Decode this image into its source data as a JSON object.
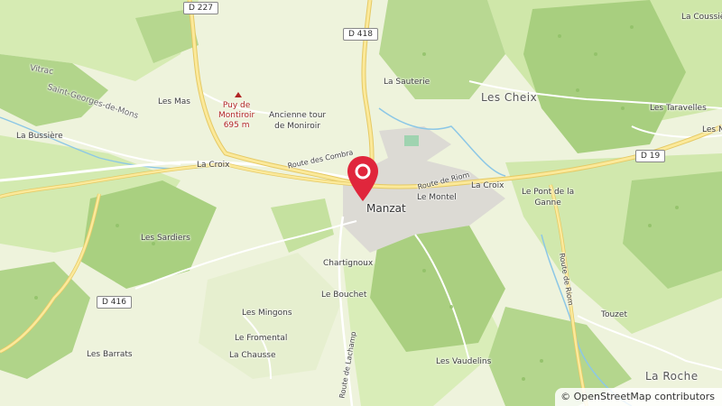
{
  "map": {
    "places": {
      "la_coussier": "La Coussièr",
      "les_cheix": "Les Cheix",
      "la_sauterie": "La Sauterie",
      "les_taravelles": "Les Taravelles",
      "les_n": "Les N",
      "vitrac": "Vitrac",
      "st_georges": "Saint-Georges-de-Mons",
      "les_mas": "Les Mas",
      "la_bussiere": "La Bussière",
      "la_croix_w": "La Croix",
      "la_croix_e": "La Croix",
      "ancienne_tour": "Ancienne tour\nde Moniroir",
      "manzat": "Manzat",
      "le_montel": "Le Montel",
      "le_pont": "Le Pont de la\nGanne",
      "les_sardiers": "Les Sardiers",
      "chartignoux": "Chartignoux",
      "le_bouchet": "Le Bouchet",
      "les_mingons": "Les Mingons",
      "le_fromental": "Le Fromental",
      "la_chausse": "La Chausse",
      "les_barrats": "Les Barrats",
      "les_vaudelins": "Les Vaudelins",
      "touzet": "Touzet",
      "la_roche": "La Roche"
    },
    "peak": "Puy de\nMontiroir\n695 m",
    "roads": {
      "d227": "D 227",
      "d418": "D 418",
      "d19": "D 19",
      "d416": "D 416",
      "combrailles": "Route des Combra",
      "riom_1": "Route de Riom",
      "riom_2": "Route de Riom",
      "lachamp": "Route de Lachamp"
    },
    "attribution": "© OpenStreetMap contributors",
    "marker_color": "#e0263c"
  }
}
